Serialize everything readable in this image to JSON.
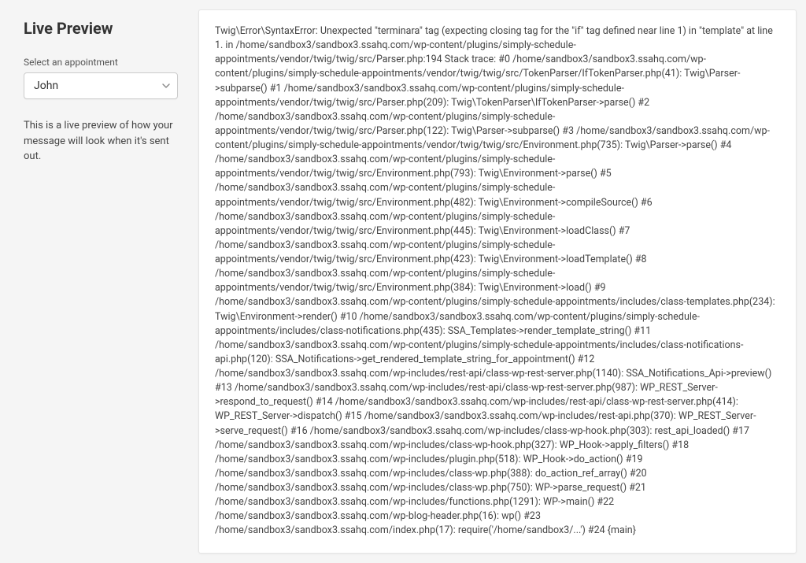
{
  "sidebar": {
    "title": "Live Preview",
    "select_label": "Select an appointment",
    "selected_value": "John",
    "help_text": "This is a live preview of how your message will look when it's sent out."
  },
  "main": {
    "error_message": "Twig\\Error\\SyntaxError: Unexpected \"terminara\" tag (expecting closing tag for the \"if\" tag defined near line 1) in \"template\" at line 1. in /home/sandbox3/sandbox3.ssahq.com/wp-content/plugins/simply-schedule-appointments/vendor/twig/twig/src/Parser.php:194 Stack trace: #0 /home/sandbox3/sandbox3.ssahq.com/wp-content/plugins/simply-schedule-appointments/vendor/twig/twig/src/TokenParser/IfTokenParser.php(41): Twig\\Parser->subparse() #1 /home/sandbox3/sandbox3.ssahq.com/wp-content/plugins/simply-schedule-appointments/vendor/twig/twig/src/Parser.php(209): Twig\\TokenParser\\IfTokenParser->parse() #2 /home/sandbox3/sandbox3.ssahq.com/wp-content/plugins/simply-schedule-appointments/vendor/twig/twig/src/Parser.php(122): Twig\\Parser->subparse() #3 /home/sandbox3/sandbox3.ssahq.com/wp-content/plugins/simply-schedule-appointments/vendor/twig/twig/src/Environment.php(735): Twig\\Parser->parse() #4 /home/sandbox3/sandbox3.ssahq.com/wp-content/plugins/simply-schedule-appointments/vendor/twig/twig/src/Environment.php(793): Twig\\Environment->parse() #5 /home/sandbox3/sandbox3.ssahq.com/wp-content/plugins/simply-schedule-appointments/vendor/twig/twig/src/Environment.php(482): Twig\\Environment->compileSource() #6 /home/sandbox3/sandbox3.ssahq.com/wp-content/plugins/simply-schedule-appointments/vendor/twig/twig/src/Environment.php(445): Twig\\Environment->loadClass() #7 /home/sandbox3/sandbox3.ssahq.com/wp-content/plugins/simply-schedule-appointments/vendor/twig/twig/src/Environment.php(423): Twig\\Environment->loadTemplate() #8 /home/sandbox3/sandbox3.ssahq.com/wp-content/plugins/simply-schedule-appointments/vendor/twig/twig/src/Environment.php(384): Twig\\Environment->load() #9 /home/sandbox3/sandbox3.ssahq.com/wp-content/plugins/simply-schedule-appointments/includes/class-templates.php(234): Twig\\Environment->render() #10 /home/sandbox3/sandbox3.ssahq.com/wp-content/plugins/simply-schedule-appointments/includes/class-notifications.php(435): SSA_Templates->render_template_string() #11 /home/sandbox3/sandbox3.ssahq.com/wp-content/plugins/simply-schedule-appointments/includes/class-notifications-api.php(120): SSA_Notifications->get_rendered_template_string_for_appointment() #12 /home/sandbox3/sandbox3.ssahq.com/wp-includes/rest-api/class-wp-rest-server.php(1140): SSA_Notifications_Api->preview() #13 /home/sandbox3/sandbox3.ssahq.com/wp-includes/rest-api/class-wp-rest-server.php(987): WP_REST_Server->respond_to_request() #14 /home/sandbox3/sandbox3.ssahq.com/wp-includes/rest-api/class-wp-rest-server.php(414): WP_REST_Server->dispatch() #15 /home/sandbox3/sandbox3.ssahq.com/wp-includes/rest-api.php(370): WP_REST_Server->serve_request() #16 /home/sandbox3/sandbox3.ssahq.com/wp-includes/class-wp-hook.php(303): rest_api_loaded() #17 /home/sandbox3/sandbox3.ssahq.com/wp-includes/class-wp-hook.php(327): WP_Hook->apply_filters() #18 /home/sandbox3/sandbox3.ssahq.com/wp-includes/plugin.php(518): WP_Hook->do_action() #19 /home/sandbox3/sandbox3.ssahq.com/wp-includes/class-wp.php(388): do_action_ref_array() #20 /home/sandbox3/sandbox3.ssahq.com/wp-includes/class-wp.php(750): WP->parse_request() #21 /home/sandbox3/sandbox3.ssahq.com/wp-includes/functions.php(1291): WP->main() #22 /home/sandbox3/sandbox3.ssahq.com/wp-blog-header.php(16): wp() #23 /home/sandbox3/sandbox3.ssahq.com/index.php(17): require('/home/sandbox3/...') #24 {main}"
  }
}
